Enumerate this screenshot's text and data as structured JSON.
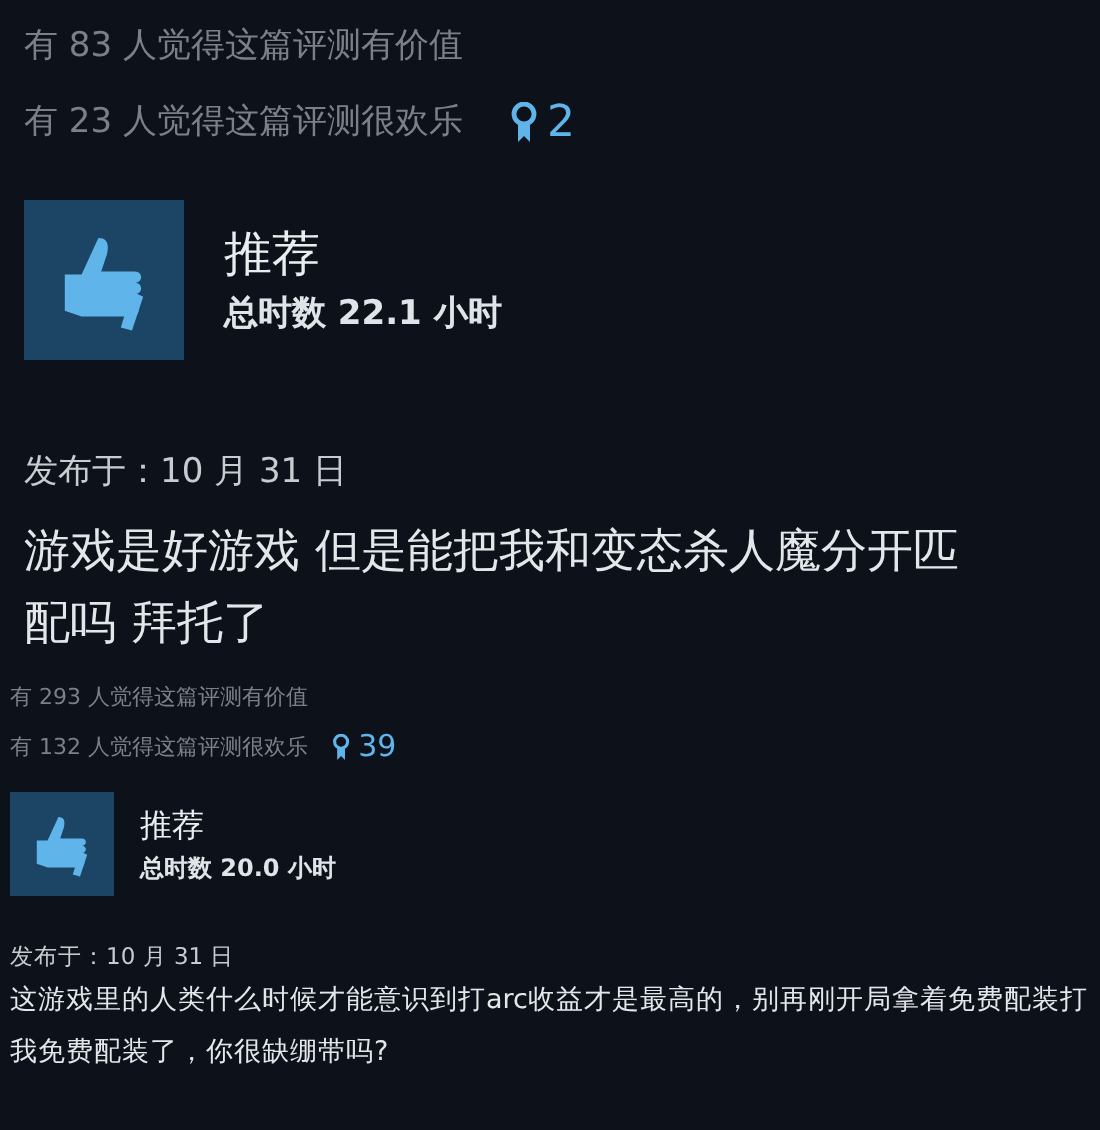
{
  "sections": [
    {
      "kind": "large",
      "helpful": "有 83 人觉得这篇评测有价值",
      "funny": "有 23 人觉得这篇评测很欢乐",
      "awards": "2",
      "recommendation": "推荐",
      "hours": "总时数 22.1 小时",
      "posted": "发布于：10 月 31 日",
      "body": "游戏是好游戏 但是能把我和变态杀人魔分开匹配吗 拜托了"
    },
    {
      "kind": "small",
      "helpful": "有 293 人觉得这篇评测有价值",
      "funny": "有 132 人觉得这篇评测很欢乐",
      "awards": "39",
      "recommendation": "推荐",
      "hours": "总时数 20.0 小时",
      "posted": "发布于：10 月 31 日",
      "body": "这游戏里的人类什么时候才能意识到打arc收益才是最高的，别再刚开局拿着免费配装打我免费配装了，你很缺绷带吗?"
    }
  ]
}
